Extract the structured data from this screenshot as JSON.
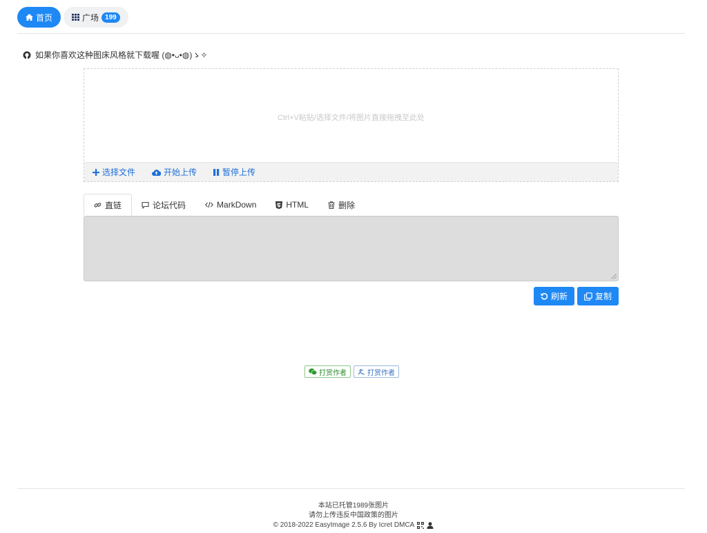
{
  "nav": {
    "home_label": "首页",
    "square_label": "广场",
    "square_count": "199",
    "home_icon": "home-icon",
    "square_icon": "grid-icon"
  },
  "notice": {
    "text": "如果你喜欢这种图床风格就下载喔 (◍•ᴗ•◍)ゝ✧",
    "icon": "github-icon"
  },
  "upload": {
    "drop_hint": "Ctrl+V粘贴/选择文件/将图片直接拖拽至此处",
    "select_label": "选择文件",
    "start_label": "开始上传",
    "pause_label": "暂停上传"
  },
  "tabs": [
    {
      "label": "直链",
      "icon": "link-icon"
    },
    {
      "label": "论坛代码",
      "icon": "comment-icon"
    },
    {
      "label": "MarkDown",
      "icon": "code-icon"
    },
    {
      "label": "HTML",
      "icon": "html5-icon"
    },
    {
      "label": "删除",
      "icon": "trash-icon"
    }
  ],
  "actions": {
    "refresh_label": "刷新",
    "copy_label": "复制"
  },
  "donate": {
    "wechat_label": "打赏作者",
    "alipay_label": "打赏作者"
  },
  "footer": {
    "line1": "本站已托管1989张图片",
    "line2": "请勿上传违反中国政策的图片",
    "line3": "© 2018-2022 EasyImage 2.5.6 By Icret DMCA"
  },
  "colors": {
    "accent": "#1e88f5",
    "link": "#1e6fd9",
    "output_bg": "#dddddd"
  }
}
